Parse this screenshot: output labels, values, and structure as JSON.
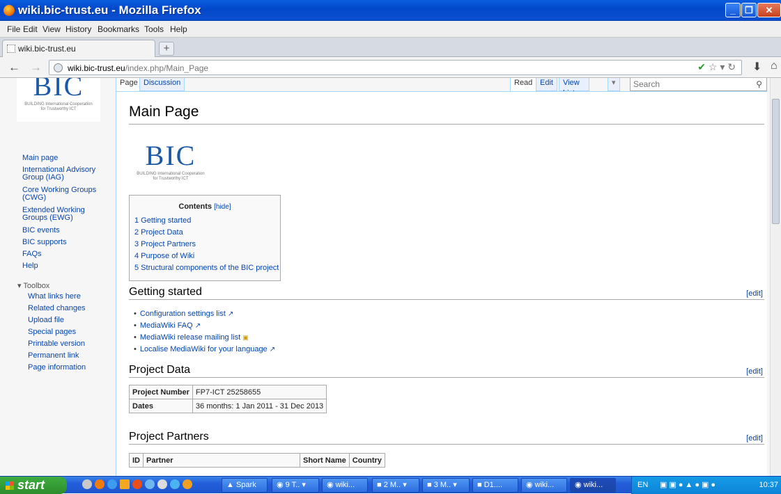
{
  "window": {
    "title": "wiki.bic-trust.eu - Mozilla Firefox"
  },
  "menu": [
    "File",
    "Edit",
    "View",
    "History",
    "Bookmarks",
    "Tools",
    "Help"
  ],
  "tab": {
    "label": "wiki.bic-trust.eu",
    "new_tab": "+"
  },
  "nav": {
    "back": "←",
    "forward": "→",
    "url_domain": "wiki.bic-trust.eu",
    "url_path": "/index.php/Main_Page",
    "home": "⌂",
    "download": "⬇"
  },
  "logo": {
    "text": "BIC",
    "subtitle_1": "BUILDING International Cooperation",
    "subtitle_2": "for Trustworthy ICT"
  },
  "sidebar": {
    "links": [
      "Main page",
      "International Advisory Group (IAG)",
      "Core Working Groups (CWG)",
      "Extended Working Groups (EWG)",
      "BIC events",
      "BIC supports",
      "FAQs",
      "Help"
    ],
    "toolbox_label": "Toolbox",
    "toolbox": [
      "What links here",
      "Related changes",
      "Upload file",
      "Special pages",
      "Printable version",
      "Permanent link",
      "Page information"
    ]
  },
  "page_tabs": {
    "page": "Page",
    "discussion": "Discussion",
    "read": "Read",
    "edit": "Edit",
    "view_history": "View history"
  },
  "search": {
    "placeholder": "Search"
  },
  "content": {
    "title": "Main Page",
    "toc": {
      "title": "Contents",
      "hide": "[hide]",
      "items": [
        "1 Getting started",
        "2 Project Data",
        "3 Project Partners",
        "4 Purpose of Wiki",
        "5 Structural components of the BIC project"
      ]
    },
    "edit_label": "[edit]",
    "getting_started": {
      "heading": "Getting started",
      "links": [
        "Configuration settings list",
        "MediaWiki FAQ",
        "MediaWiki release mailing list",
        "Localise MediaWiki for your language"
      ]
    },
    "project_data": {
      "heading": "Project Data",
      "rows": [
        {
          "label": "Project Number",
          "value": "FP7-ICT 25258655"
        },
        {
          "label": "Dates",
          "value": "36 months: 1 Jan 2011 - 31 Dec 2013"
        }
      ]
    },
    "project_partners": {
      "heading": "Project Partners",
      "columns": [
        "ID",
        "Partner",
        "Short Name",
        "Country"
      ]
    }
  },
  "taskbar": {
    "start": "start",
    "buttons": [
      "Spark",
      "9 T..",
      "wiki...",
      "2 M..",
      "3 M..",
      "D1....",
      "wiki...",
      "wiki..."
    ],
    "lang": "EN",
    "time": "10:37"
  }
}
